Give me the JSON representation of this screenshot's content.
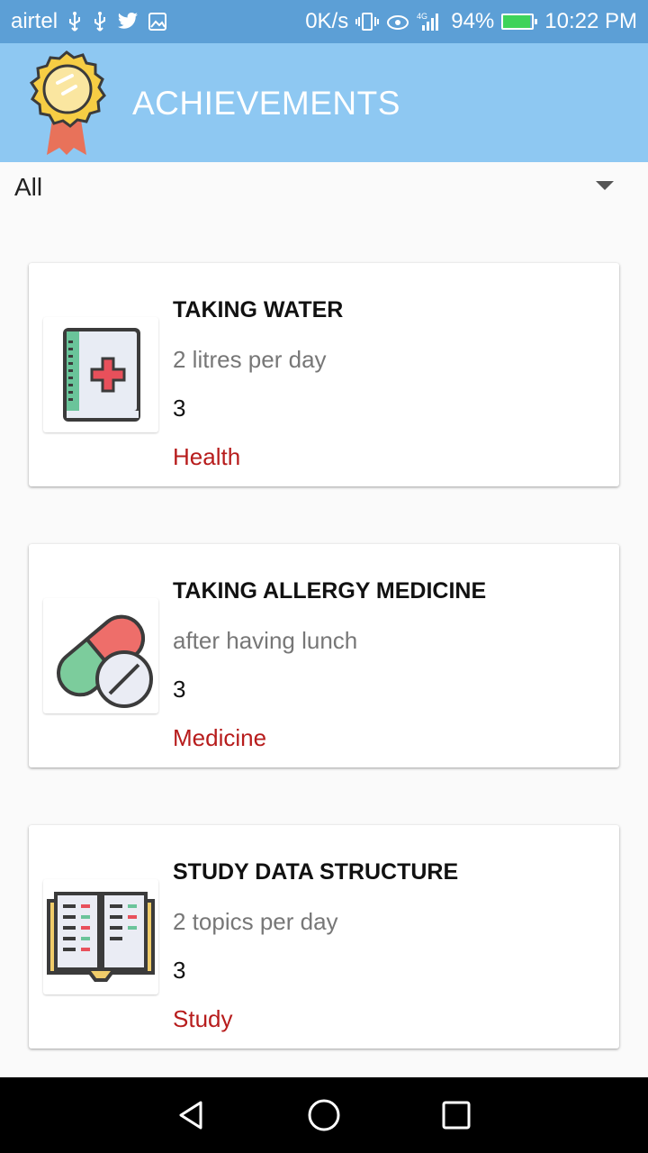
{
  "status_bar": {
    "carrier": "airtel",
    "network_speed": "0K/s",
    "network_type": "4G",
    "battery_percent": "94%",
    "battery_level": 0.94,
    "time": "10:22 PM"
  },
  "app_bar": {
    "title": "ACHIEVEMENTS",
    "logo_icon": "award-ribbon-icon"
  },
  "filter": {
    "selected": "All"
  },
  "achievements": [
    {
      "title": "TAKING WATER",
      "description": "2 litres per day",
      "count": "3",
      "category": "Health",
      "icon": "medical-book-icon"
    },
    {
      "title": "TAKING ALLERGY MEDICINE",
      "description": "after having lunch",
      "count": "3",
      "category": "Medicine",
      "icon": "pills-icon"
    },
    {
      "title": "STUDY DATA STRUCTURE",
      "description": "2 topics per day",
      "count": "3",
      "category": "Study",
      "icon": "open-book-icon"
    }
  ],
  "colors": {
    "status_bar": "#5c9fd6",
    "app_bar": "#8ec8f2",
    "category_text": "#b71c1c"
  }
}
